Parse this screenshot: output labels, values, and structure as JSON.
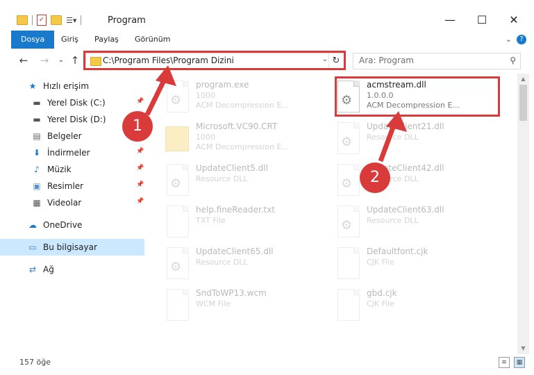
{
  "window": {
    "title": "Program",
    "controls": {
      "minimize": "—",
      "maximize": "☐",
      "close": "✕"
    }
  },
  "ribbon": {
    "tabs": [
      "Dosya",
      "Giriş",
      "Paylaş",
      "Görünüm"
    ],
    "help": "?",
    "expand": "⌄"
  },
  "navigation": {
    "back": "←",
    "forward": "→",
    "dropdown": "⌄",
    "up": "↑",
    "address": "C:\\Program Files\\Program Dizini",
    "search_placeholder": "Ara: Program"
  },
  "sidebar": {
    "items": [
      {
        "label": "Hızlı erişim",
        "icon": "star-icon",
        "pinned": false
      },
      {
        "label": "Yerel Disk (C:)",
        "icon": "drive-icon",
        "pinned": true
      },
      {
        "label": "Yerel Disk (D:)",
        "icon": "drive-icon",
        "pinned": false
      },
      {
        "label": "Belgeler",
        "icon": "documents-icon",
        "pinned": false
      },
      {
        "label": "İndirmeler",
        "icon": "download-icon",
        "pinned": true
      },
      {
        "label": "Müzik",
        "icon": "music-icon",
        "pinned": true
      },
      {
        "label": "Resimler",
        "icon": "pictures-icon",
        "pinned": true
      },
      {
        "label": "Videolar",
        "icon": "video-icon",
        "pinned": true
      },
      {
        "label": "OneDrive",
        "icon": "cloud-icon",
        "pinned": false
      },
      {
        "label": "Bu bilgisayar",
        "icon": "computer-icon",
        "pinned": false,
        "selected": true
      },
      {
        "label": "Ağ",
        "icon": "network-icon",
        "pinned": false
      }
    ]
  },
  "files": [
    {
      "name": "program.exe",
      "line2": "1000",
      "line3": "ACM Decompression E...",
      "dim": true
    },
    {
      "name": "acmstream.dll",
      "line2": "1.0.0.0",
      "line3": "ACM Decompression E...",
      "dim": false
    },
    {
      "name": "Microsoft.VC90.CRT",
      "line2": "1000",
      "line3": "ACM Decompression E...",
      "dim": true
    },
    {
      "name": "UpdateClient21.dll",
      "line2": "Resource DLL",
      "line3": "",
      "dim": true
    },
    {
      "name": "UpdateClient5.dll",
      "line2": "Resource DLL",
      "line3": "",
      "dim": true
    },
    {
      "name": "UpdateClient42.dll",
      "line2": "Resource DLL",
      "line3": "",
      "dim": true
    },
    {
      "name": "help.fineReader.txt",
      "line2": "TXT File",
      "line3": "",
      "dim": true
    },
    {
      "name": "UpdateClient63.dll",
      "line2": "Resource DLL",
      "line3": "",
      "dim": true
    },
    {
      "name": "UpdateClient65.dll",
      "line2": "Resource DLL",
      "line3": "",
      "dim": true
    },
    {
      "name": "Defaultfont.cjk",
      "line2": "CJK File",
      "line3": "",
      "dim": true
    },
    {
      "name": "SndToWP13.wcm",
      "line2": "WCM File",
      "line3": "",
      "dim": true
    },
    {
      "name": "gbd.cjk",
      "line2": "CJK File",
      "line3": "",
      "dim": true
    }
  ],
  "annotations": {
    "badge1": "1",
    "badge2": "2",
    "highlight_color": "#d93a3a"
  },
  "status": {
    "count": "157 öğe"
  },
  "colors": {
    "accent": "#1979ca",
    "selected": "#cce8ff",
    "folder": "#f4c94a"
  }
}
